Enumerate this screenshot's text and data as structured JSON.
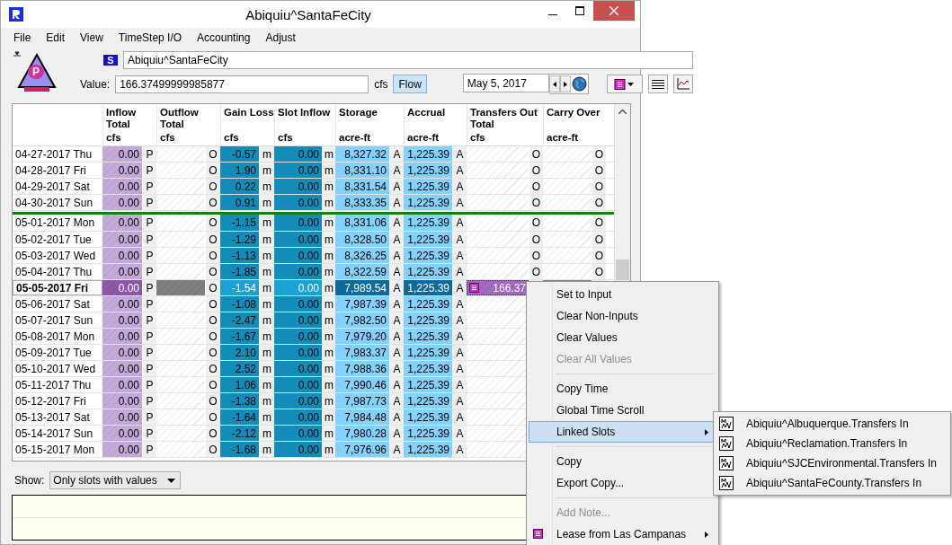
{
  "window": {
    "title": "Abiquiu^SantaFeCity"
  },
  "menu_bar": [
    "File",
    "Edit",
    "View",
    "TimeStep I/O",
    "Accounting",
    "Adjust"
  ],
  "slot": {
    "object_letter": "P",
    "slot_badge": "S",
    "name": "Abiquiu^SantaFeCity",
    "value_label": "Value:",
    "value": "166.37499999985877",
    "unit": "cfs",
    "flow_button": {
      "label": "Flow",
      "on": true
    },
    "date": "May 5, 2017"
  },
  "table": {
    "columns": [
      {
        "label": [
          "Inflow",
          "Total"
        ],
        "unit": "cfs",
        "kind": "input"
      },
      {
        "label": [
          "Outflow",
          "Total"
        ],
        "unit": "cfs",
        "kind": "output"
      },
      {
        "label": [
          "Gain Loss"
        ],
        "unit": "cfs",
        "kind": "computed"
      },
      {
        "label": [
          "Slot Inflow"
        ],
        "unit": "cfs",
        "kind": "computed"
      },
      {
        "label": [
          "Storage"
        ],
        "unit": "acre-ft",
        "kind": "accounting"
      },
      {
        "label": [
          "Accrual"
        ],
        "unit": "acre-ft",
        "kind": "accounting"
      },
      {
        "label": [
          "Transfers Out",
          "Total"
        ],
        "unit": "cfs",
        "kind": "output"
      },
      {
        "label": [
          "Carry Over"
        ],
        "unit": "acre-ft",
        "kind": "output"
      }
    ],
    "rows": [
      {
        "date": "04-27-2017 Thu",
        "selected": false,
        "boundary": false,
        "cells": [
          {
            "value": "0.00",
            "flag": "P"
          },
          {
            "flag": "O"
          },
          {
            "value": "-0.57",
            "flag": "m"
          },
          {
            "value": "0.00",
            "flag": "m"
          },
          {
            "value": "8,327.32",
            "flag": "A"
          },
          {
            "value": "1,225.39",
            "flag": "A"
          },
          {
            "flag": "O"
          },
          {
            "flag": "O"
          }
        ]
      },
      {
        "date": "04-28-2017 Fri",
        "selected": false,
        "boundary": false,
        "cells": [
          {
            "value": "0.00",
            "flag": "P"
          },
          {
            "flag": "O"
          },
          {
            "value": "1.90",
            "flag": "m"
          },
          {
            "value": "0.00",
            "flag": "m"
          },
          {
            "value": "8,331.10",
            "flag": "A"
          },
          {
            "value": "1,225.39",
            "flag": "A"
          },
          {
            "flag": "O"
          },
          {
            "flag": "O"
          }
        ]
      },
      {
        "date": "04-29-2017 Sat",
        "selected": false,
        "boundary": false,
        "cells": [
          {
            "value": "0.00",
            "flag": "P"
          },
          {
            "flag": "O"
          },
          {
            "value": "0.22",
            "flag": "m"
          },
          {
            "value": "0.00",
            "flag": "m"
          },
          {
            "value": "8,331.54",
            "flag": "A"
          },
          {
            "value": "1,225.39",
            "flag": "A"
          },
          {
            "flag": "O"
          },
          {
            "flag": "O"
          }
        ]
      },
      {
        "date": "04-30-2017 Sun",
        "selected": false,
        "boundary": false,
        "cells": [
          {
            "value": "0.00",
            "flag": "P"
          },
          {
            "flag": "O"
          },
          {
            "value": "0.91",
            "flag": "m"
          },
          {
            "value": "0.00",
            "flag": "m"
          },
          {
            "value": "8,333.35",
            "flag": "A"
          },
          {
            "value": "1,225.39",
            "flag": "A"
          },
          {
            "flag": "O"
          },
          {
            "flag": "O"
          }
        ]
      },
      {
        "date": "05-01-2017 Mon",
        "selected": false,
        "boundary": true,
        "cells": [
          {
            "value": "0.00",
            "flag": "P"
          },
          {
            "flag": "O"
          },
          {
            "value": "-1.15",
            "flag": "m"
          },
          {
            "value": "0.00",
            "flag": "m"
          },
          {
            "value": "8,331.06",
            "flag": "A"
          },
          {
            "value": "1,225.39",
            "flag": "A"
          },
          {
            "flag": "O"
          },
          {
            "flag": "O"
          }
        ]
      },
      {
        "date": "05-02-2017 Tue",
        "selected": false,
        "boundary": false,
        "cells": [
          {
            "value": "0.00",
            "flag": "P"
          },
          {
            "flag": "O"
          },
          {
            "value": "-1.29",
            "flag": "m"
          },
          {
            "value": "0.00",
            "flag": "m"
          },
          {
            "value": "8,328.50",
            "flag": "A"
          },
          {
            "value": "1,225.39",
            "flag": "A"
          },
          {
            "flag": "O"
          },
          {
            "flag": "O"
          }
        ]
      },
      {
        "date": "05-03-2017 Wed",
        "selected": false,
        "boundary": false,
        "cells": [
          {
            "value": "0.00",
            "flag": "P"
          },
          {
            "flag": "O"
          },
          {
            "value": "-1.13",
            "flag": "m"
          },
          {
            "value": "0.00",
            "flag": "m"
          },
          {
            "value": "8,326.25",
            "flag": "A"
          },
          {
            "value": "1,225.39",
            "flag": "A"
          },
          {
            "flag": "O"
          },
          {
            "flag": "O"
          }
        ]
      },
      {
        "date": "05-04-2017 Thu",
        "selected": false,
        "boundary": false,
        "cells": [
          {
            "value": "0.00",
            "flag": "P"
          },
          {
            "flag": "O"
          },
          {
            "value": "-1.85",
            "flag": "m"
          },
          {
            "value": "0.00",
            "flag": "m"
          },
          {
            "value": "8,322.59",
            "flag": "A"
          },
          {
            "value": "1,225.39",
            "flag": "A"
          },
          {
            "flag": "O"
          },
          {
            "flag": "O"
          }
        ]
      },
      {
        "date": "05-05-2017 Fri",
        "selected": true,
        "boundary": false,
        "cells": [
          {
            "value": "0.00",
            "flag": "P"
          },
          {
            "flag": "O"
          },
          {
            "value": "-1.54",
            "flag": "m"
          },
          {
            "value": "0.00",
            "flag": "m"
          },
          {
            "value": "7,989.54",
            "flag": "A"
          },
          {
            "value": "1,225.39",
            "flag": "A"
          },
          {
            "value": "166.37",
            "note": true,
            "focused": true
          },
          {}
        ]
      },
      {
        "date": "05-06-2017 Sat",
        "selected": false,
        "boundary": false,
        "cells": [
          {
            "value": "0.00",
            "flag": "P"
          },
          {
            "flag": "O"
          },
          {
            "value": "-1.08",
            "flag": "m"
          },
          {
            "value": "0.00",
            "flag": "m"
          },
          {
            "value": "7,987.39",
            "flag": "A"
          },
          {
            "value": "1,225.39",
            "flag": "A"
          },
          {},
          {}
        ]
      },
      {
        "date": "05-07-2017 Sun",
        "selected": false,
        "boundary": false,
        "cells": [
          {
            "value": "0.00",
            "flag": "P"
          },
          {
            "flag": "O"
          },
          {
            "value": "-2.47",
            "flag": "m"
          },
          {
            "value": "0.00",
            "flag": "m"
          },
          {
            "value": "7,982.50",
            "flag": "A"
          },
          {
            "value": "1,225.39",
            "flag": "A"
          },
          {},
          {}
        ]
      },
      {
        "date": "05-08-2017 Mon",
        "selected": false,
        "boundary": false,
        "cells": [
          {
            "value": "0.00",
            "flag": "P"
          },
          {
            "flag": "O"
          },
          {
            "value": "-1.67",
            "flag": "m"
          },
          {
            "value": "0.00",
            "flag": "m"
          },
          {
            "value": "7,979.20",
            "flag": "A"
          },
          {
            "value": "1,225.39",
            "flag": "A"
          },
          {},
          {}
        ]
      },
      {
        "date": "05-09-2017 Tue",
        "selected": false,
        "boundary": false,
        "cells": [
          {
            "value": "0.00",
            "flag": "P"
          },
          {
            "flag": "O"
          },
          {
            "value": "2.10",
            "flag": "m"
          },
          {
            "value": "0.00",
            "flag": "m"
          },
          {
            "value": "7,983.37",
            "flag": "A"
          },
          {
            "value": "1,225.39",
            "flag": "A"
          },
          {},
          {}
        ]
      },
      {
        "date": "05-10-2017 Wed",
        "selected": false,
        "boundary": false,
        "cells": [
          {
            "value": "0.00",
            "flag": "P"
          },
          {
            "flag": "O"
          },
          {
            "value": "2.52",
            "flag": "m"
          },
          {
            "value": "0.00",
            "flag": "m"
          },
          {
            "value": "7,988.36",
            "flag": "A"
          },
          {
            "value": "1,225.39",
            "flag": "A"
          },
          {},
          {}
        ]
      },
      {
        "date": "05-11-2017 Thu",
        "selected": false,
        "boundary": false,
        "cells": [
          {
            "value": "0.00",
            "flag": "P"
          },
          {
            "flag": "O"
          },
          {
            "value": "1.06",
            "flag": "m"
          },
          {
            "value": "0.00",
            "flag": "m"
          },
          {
            "value": "7,990.46",
            "flag": "A"
          },
          {
            "value": "1,225.39",
            "flag": "A"
          },
          {},
          {}
        ]
      },
      {
        "date": "05-12-2017 Fri",
        "selected": false,
        "boundary": false,
        "cells": [
          {
            "value": "0.00",
            "flag": "P"
          },
          {
            "flag": "O"
          },
          {
            "value": "-1.38",
            "flag": "m"
          },
          {
            "value": "0.00",
            "flag": "m"
          },
          {
            "value": "7,987.73",
            "flag": "A"
          },
          {
            "value": "1,225.39",
            "flag": "A"
          },
          {},
          {}
        ]
      },
      {
        "date": "05-13-2017 Sat",
        "selected": false,
        "boundary": false,
        "cells": [
          {
            "value": "0.00",
            "flag": "P"
          },
          {
            "flag": "O"
          },
          {
            "value": "-1.64",
            "flag": "m"
          },
          {
            "value": "0.00",
            "flag": "m"
          },
          {
            "value": "7,984.48",
            "flag": "A"
          },
          {
            "value": "1,225.39",
            "flag": "A"
          },
          {},
          {}
        ]
      },
      {
        "date": "05-14-2017 Sun",
        "selected": false,
        "boundary": false,
        "cells": [
          {
            "value": "0.00",
            "flag": "P"
          },
          {
            "flag": "O"
          },
          {
            "value": "-2.12",
            "flag": "m"
          },
          {
            "value": "0.00",
            "flag": "m"
          },
          {
            "value": "7,980.28",
            "flag": "A"
          },
          {
            "value": "1,225.39",
            "flag": "A"
          },
          {},
          {}
        ]
      },
      {
        "date": "05-15-2017 Mon",
        "selected": false,
        "boundary": false,
        "cells": [
          {
            "value": "0.00",
            "flag": "P"
          },
          {
            "flag": "O"
          },
          {
            "value": "-1.68",
            "flag": "m"
          },
          {
            "value": "0.00",
            "flag": "m"
          },
          {
            "value": "7,976.96",
            "flag": "A"
          },
          {
            "value": "1,225.39",
            "flag": "A"
          },
          {},
          {}
        ]
      }
    ]
  },
  "show": {
    "label": "Show:",
    "value": "Only slots with values"
  },
  "context_menu": {
    "items": [
      {
        "kind": "item",
        "label": "Set to Input",
        "disabled": false,
        "selected": false
      },
      {
        "kind": "item",
        "label": "Clear Non-Inputs",
        "disabled": false,
        "selected": false
      },
      {
        "kind": "item",
        "label": "Clear Values",
        "disabled": false,
        "selected": false
      },
      {
        "kind": "item",
        "label": "Clear All Values",
        "disabled": true,
        "selected": false
      },
      {
        "kind": "separator"
      },
      {
        "kind": "item",
        "label": "Copy Time",
        "disabled": false,
        "selected": false
      },
      {
        "kind": "item",
        "label": "Global Time Scroll",
        "disabled": false,
        "selected": false
      },
      {
        "kind": "submenu",
        "label": "Linked Slots",
        "disabled": false,
        "selected": true
      },
      {
        "kind": "separator"
      },
      {
        "kind": "item",
        "label": "Copy",
        "disabled": false,
        "selected": false
      },
      {
        "kind": "item",
        "label": "Export Copy...",
        "disabled": false,
        "selected": false
      },
      {
        "kind": "separator"
      },
      {
        "kind": "item",
        "label": "Add Note...",
        "disabled": true,
        "selected": false
      },
      {
        "kind": "submenu",
        "label": "Lease from Las Campanas",
        "disabled": false,
        "selected": false,
        "note": true
      }
    ]
  },
  "submenu": {
    "items": [
      {
        "label": "Abiquiu^Albuquerque.Transfers In"
      },
      {
        "label": "Abiquiu^Reclamation.Transfers In"
      },
      {
        "label": "Abiquiu^SJCEnvironmental.Transfers In"
      },
      {
        "label": "Abiquiu^SantaFeCounty.Transfers In"
      }
    ]
  }
}
